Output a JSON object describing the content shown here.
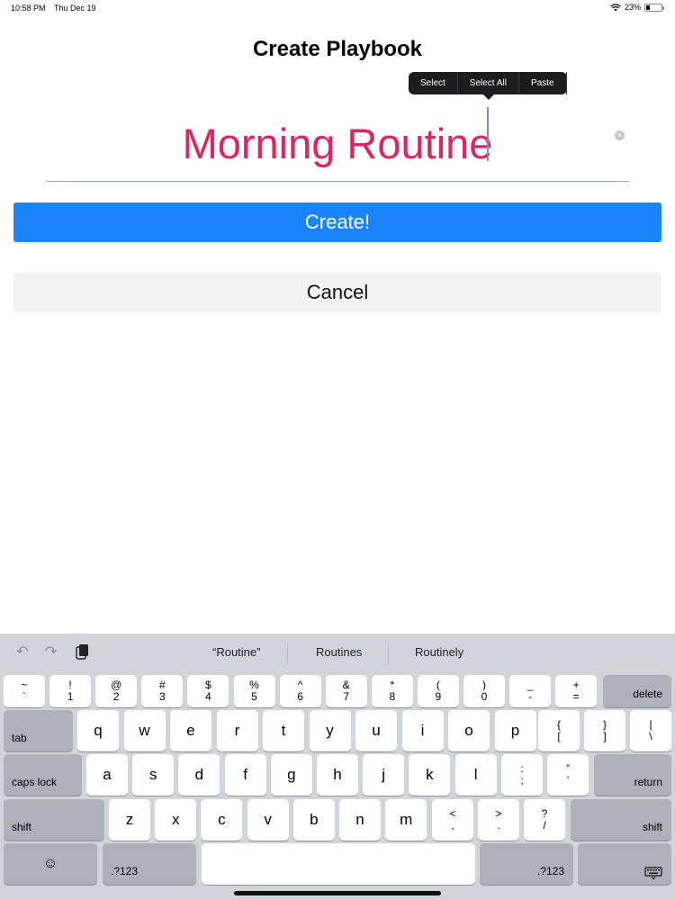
{
  "status_bar": {
    "time": "10:58 PM",
    "date": "Thu Dec 19",
    "battery_text": "23%",
    "battery_level": 0.23,
    "wifi_icon": "wifi-icon"
  },
  "page": {
    "title": "Create Playbook",
    "name_value": "Morning Routine",
    "create_label": "Create!",
    "cancel_label": "Cancel"
  },
  "edit_menu": {
    "items": [
      "Select",
      "Select All",
      "Paste"
    ]
  },
  "keyboard": {
    "suggestions": [
      "“Routine”",
      "Routines",
      "Routinely"
    ],
    "tools": [
      "undo-icon",
      "redo-icon",
      "paste-icon"
    ],
    "number_row": [
      {
        "top": "~",
        "bottom": "`"
      },
      {
        "top": "!",
        "bottom": "1"
      },
      {
        "top": "@",
        "bottom": "2"
      },
      {
        "top": "#",
        "bottom": "3"
      },
      {
        "top": "$",
        "bottom": "4"
      },
      {
        "top": "%",
        "bottom": "5"
      },
      {
        "top": "^",
        "bottom": "6"
      },
      {
        "top": "&",
        "bottom": "7"
      },
      {
        "top": "*",
        "bottom": "8"
      },
      {
        "top": "(",
        "bottom": "9"
      },
      {
        "top": ")",
        "bottom": "0"
      },
      {
        "top": "_",
        "bottom": "-"
      },
      {
        "top": "+",
        "bottom": "="
      }
    ],
    "delete_label": "delete",
    "tab_label": "tab",
    "row_q": [
      "q",
      "w",
      "e",
      "r",
      "t",
      "y",
      "u",
      "i",
      "o",
      "p"
    ],
    "row_q_sym": [
      {
        "top": "{",
        "bottom": "["
      },
      {
        "top": "}",
        "bottom": "]"
      },
      {
        "top": "|",
        "bottom": "\\"
      }
    ],
    "caps_label": "caps lock",
    "row_a": [
      "a",
      "s",
      "d",
      "f",
      "g",
      "h",
      "j",
      "k",
      "l"
    ],
    "row_a_sym": [
      {
        "top": ":",
        "bottom": ";"
      },
      {
        "top": "”",
        "bottom": "’"
      }
    ],
    "return_label": "return",
    "shift_label": "shift",
    "row_z": [
      "z",
      "x",
      "c",
      "v",
      "b",
      "n",
      "m"
    ],
    "row_z_sym": [
      {
        "top": "<",
        "bottom": ","
      },
      {
        "top": ">",
        "bottom": "."
      },
      {
        "top": "?",
        "bottom": "/"
      }
    ],
    "numbers_label": ".?123",
    "emoji_icon": "emoji-icon",
    "dismiss_icon": "keyboard-dismiss-icon"
  }
}
